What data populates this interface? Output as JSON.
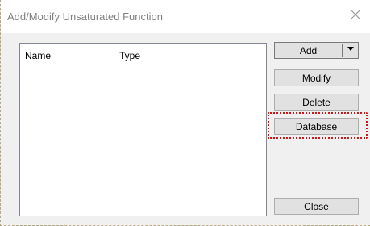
{
  "window": {
    "title": "Add/Modify Unsaturated Function",
    "close_icon": "close-icon"
  },
  "list": {
    "columns": [
      "Name",
      "Type"
    ],
    "rows": []
  },
  "buttons": {
    "add": "Add",
    "modify": "Modify",
    "delete": "Delete",
    "database": "Database",
    "close": "Close"
  },
  "colors": {
    "highlight": "#d21414",
    "dialog_bg": "#f0f0f0",
    "button_bg": "#e1e1e1"
  }
}
